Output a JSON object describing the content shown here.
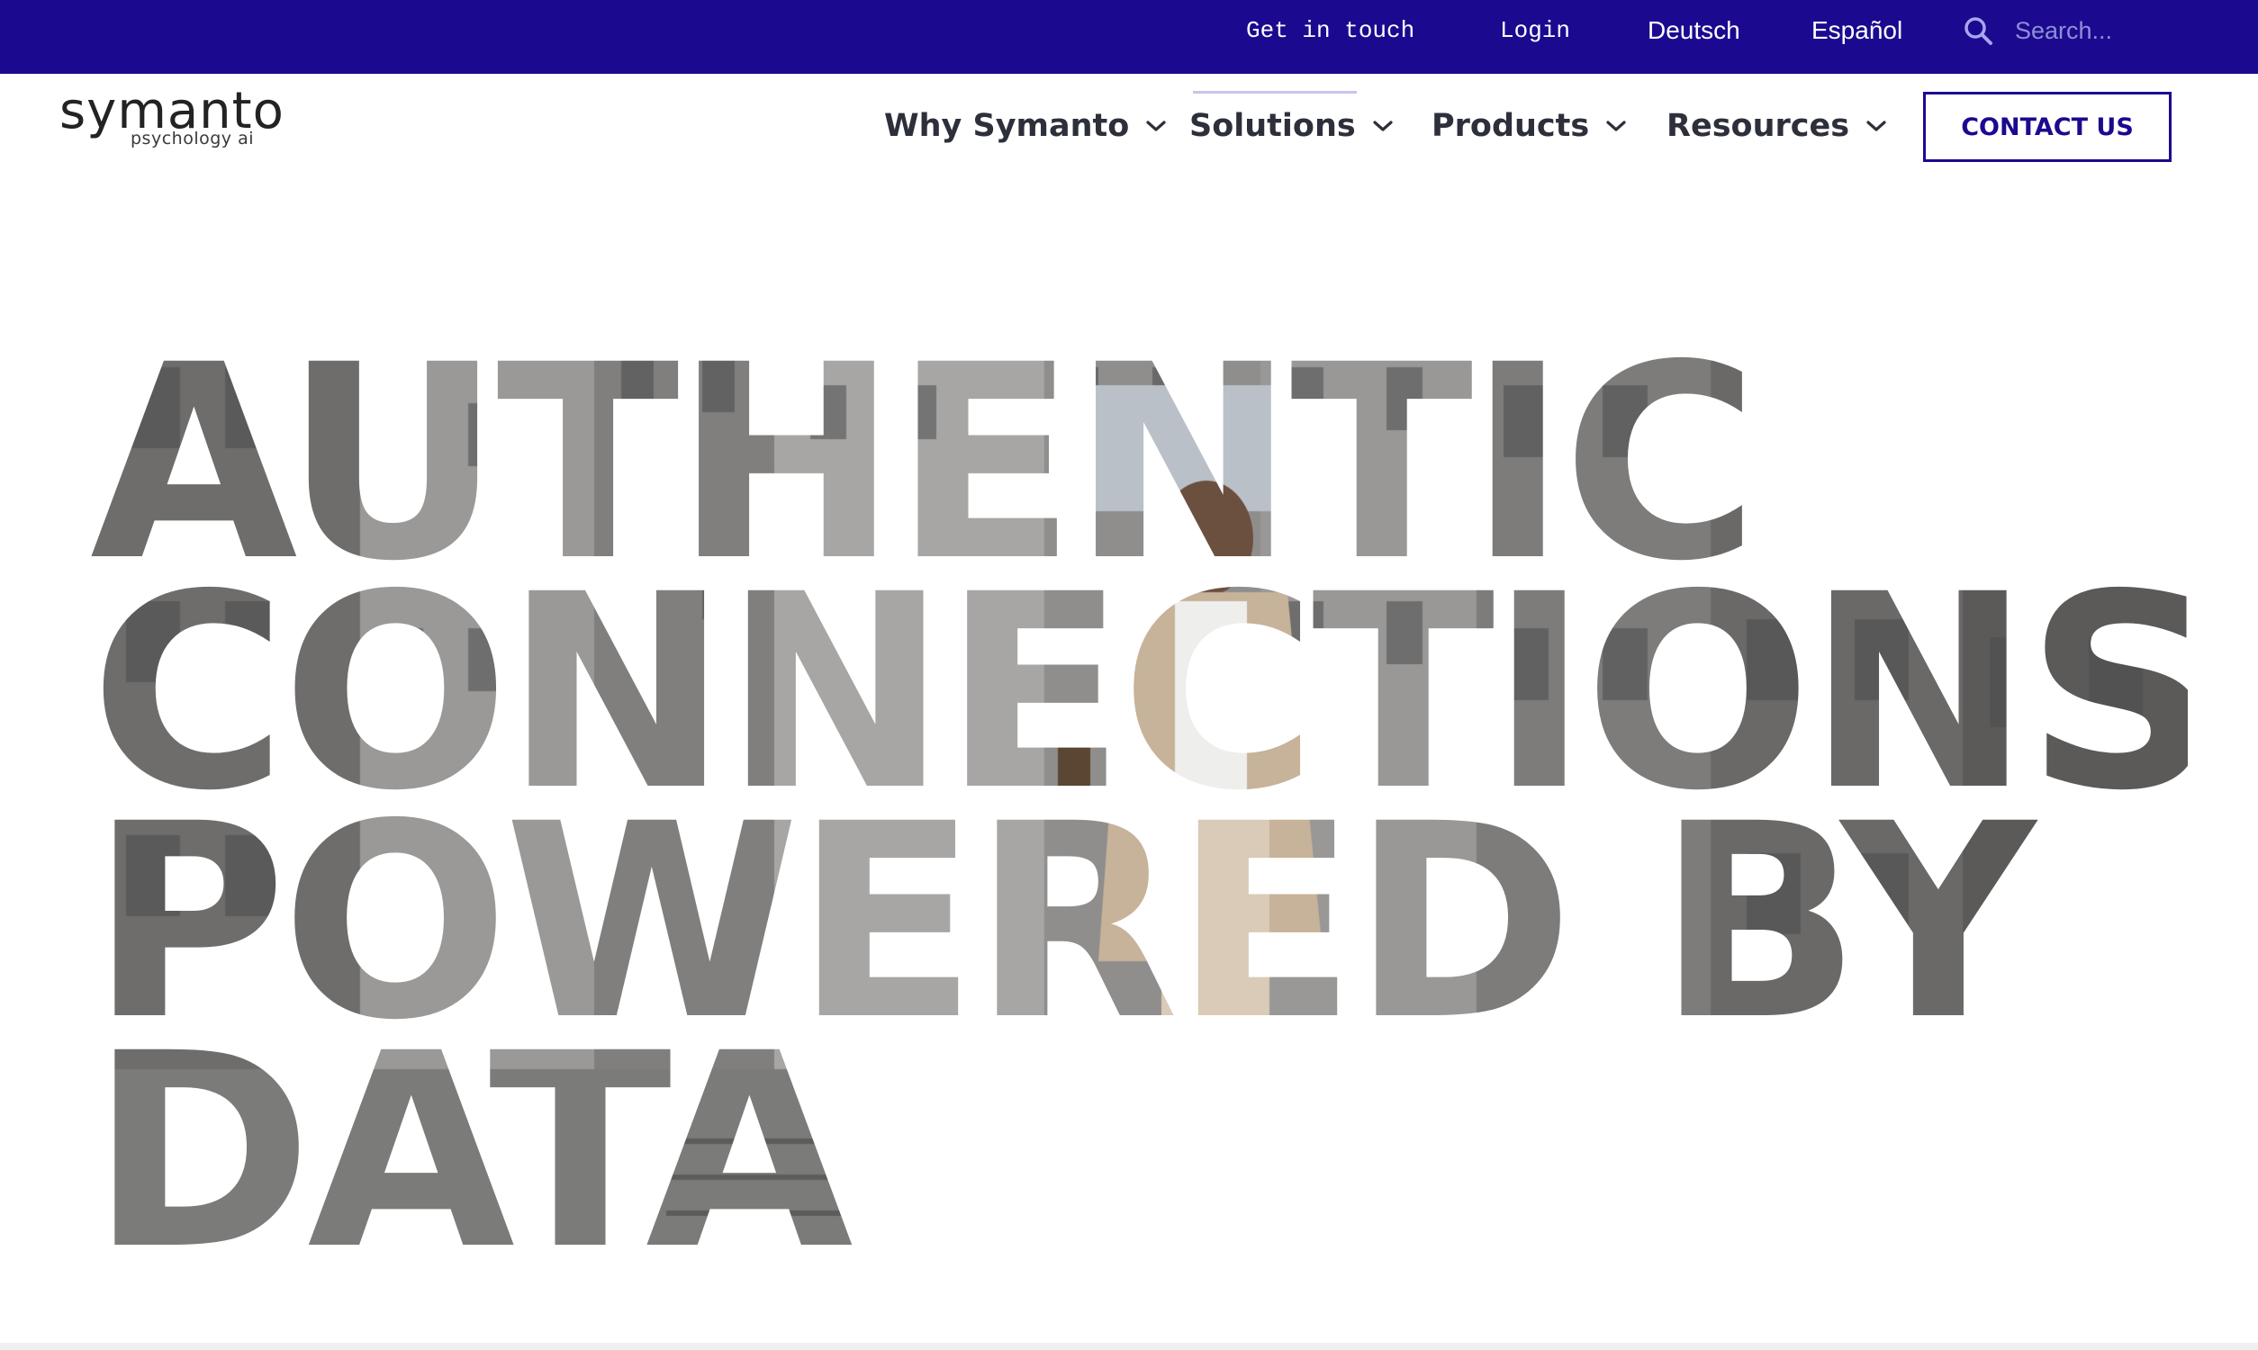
{
  "topbar": {
    "get_in_touch": "Get in touch",
    "login": "Login",
    "lang_de": "Deutsch",
    "lang_es": "Español",
    "search_placeholder": "Search...",
    "search_icon": "search-icon",
    "bg_color": "#1b0a8f"
  },
  "logo": {
    "word": "symanto",
    "tagline": "psychology ai"
  },
  "nav": {
    "items": [
      {
        "label": "Why Symanto",
        "icon": "chevron-down-icon"
      },
      {
        "label": "Solutions",
        "icon": "chevron-down-icon"
      },
      {
        "label": "Products",
        "icon": "chevron-down-icon"
      },
      {
        "label": "Resources",
        "icon": "chevron-down-icon"
      }
    ],
    "active": "Solutions",
    "contact_label": "CONTACT US",
    "accent_color": "#1b0a8f"
  },
  "hero": {
    "lines": [
      "AUTHENTIC",
      "CONNECTIONS",
      "POWERED BY",
      "DATA"
    ],
    "media": "video of woman walking between office buildings"
  }
}
